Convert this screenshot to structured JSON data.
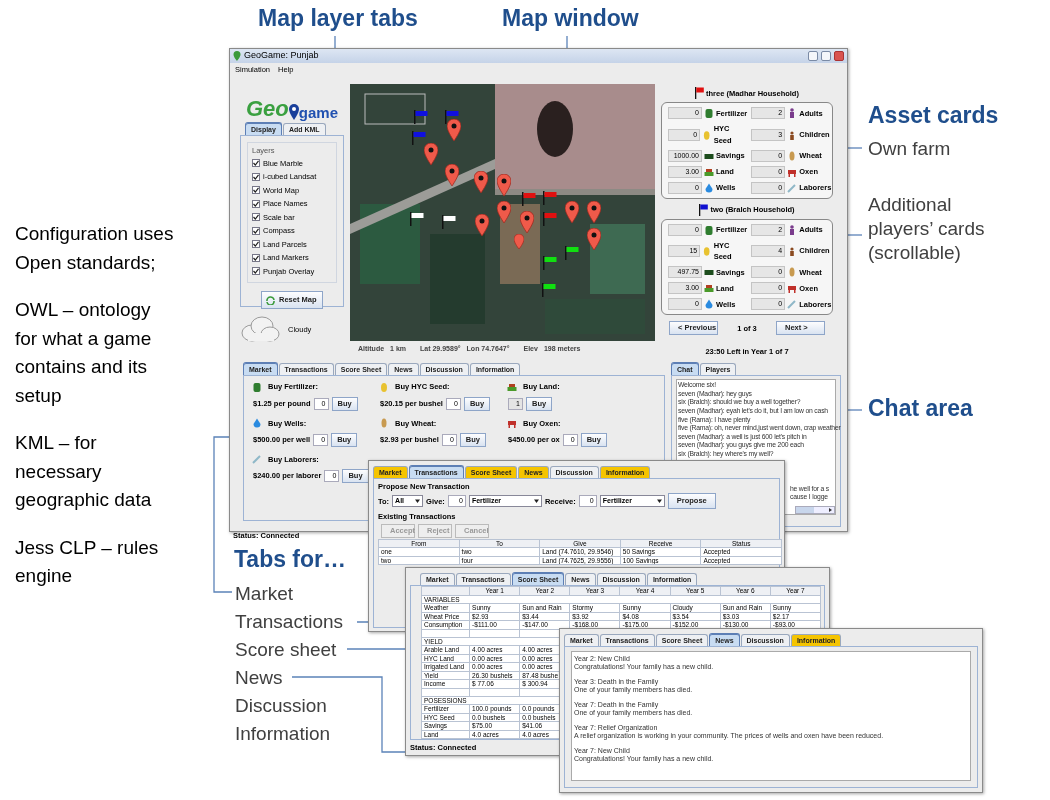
{
  "slide_notes": {
    "map_layer_tabs": "Map layer tabs",
    "map_window": "Map window",
    "asset_cards": "Asset cards",
    "own_farm": "Own farm",
    "additional": "Additional players’ cards (scrollable)",
    "chat_area": "Chat area",
    "tabs_for": "Tabs for…",
    "tab_list": [
      "Market",
      "Transactions",
      "Score sheet",
      "News",
      "Discussion",
      "Information"
    ],
    "left": [
      "Configuration uses Open standards;",
      "OWL – ontology for what a game contains and its setup",
      "KML – for necessary geographic data",
      "Jess CLP – rules engine"
    ]
  },
  "main_window": {
    "title": "GeoGame: Punjab",
    "menu": [
      "Simulation",
      "Help"
    ],
    "logo": {
      "left": "Geo",
      "right": "game"
    },
    "layer_tabs": [
      {
        "label": "Display",
        "selected": true
      },
      {
        "label": "Add KML",
        "selected": false
      }
    ],
    "layers": {
      "title": "Layers",
      "items": [
        {
          "label": "Blue Marble",
          "checked": true
        },
        {
          "label": "i-cubed Landsat",
          "checked": true
        },
        {
          "label": "World Map",
          "checked": true
        },
        {
          "label": "Place Names",
          "checked": true
        },
        {
          "label": "Scale bar",
          "checked": true
        },
        {
          "label": "Compass",
          "checked": true
        },
        {
          "label": "Land Parcels",
          "checked": true
        },
        {
          "label": "Land Markers",
          "checked": true
        },
        {
          "label": "Punjab Overlay",
          "checked": true
        }
      ]
    },
    "reset_button": "Reset Map",
    "weather": "Cloudy",
    "map": {
      "kind": "picture"
    },
    "map_readout": [
      "Altitude",
      "1 km",
      "Lat 29.9589°",
      "Lon 74.7647°",
      "Elev",
      "198 meters"
    ],
    "households": [
      {
        "title": "three (Madhar Household)",
        "color": "#e01010",
        "assets": [
          {
            "kind": "fertilizer",
            "label": "Fertilizer",
            "value": "0"
          },
          {
            "kind": "adults",
            "label": "Adults",
            "value": "2"
          },
          {
            "kind": "seed",
            "label": "HYC Seed",
            "value": "0"
          },
          {
            "kind": "children",
            "label": "Children",
            "value": "3"
          },
          {
            "kind": "savings",
            "label": "Savings",
            "value": "1000.00"
          },
          {
            "kind": "wheat",
            "label": "Wheat",
            "value": "0"
          },
          {
            "kind": "land",
            "label": "Land",
            "value": "3.00"
          },
          {
            "kind": "oxen",
            "label": "Oxen",
            "value": "0"
          },
          {
            "kind": "wells",
            "label": "Wells",
            "value": "0"
          },
          {
            "kind": "laborers",
            "label": "Laborers",
            "value": "0"
          }
        ]
      },
      {
        "title": "two (Bralch Household)",
        "color": "#1010d0",
        "assets": [
          {
            "kind": "fertilizer",
            "label": "Fertilizer",
            "value": "0"
          },
          {
            "kind": "adults",
            "label": "Adults",
            "value": "2"
          },
          {
            "kind": "seed",
            "label": "HYC Seed",
            "value": "15"
          },
          {
            "kind": "children",
            "label": "Children",
            "value": "4"
          },
          {
            "kind": "savings",
            "label": "Savings",
            "value": "497.75"
          },
          {
            "kind": "wheat",
            "label": "Wheat",
            "value": "0"
          },
          {
            "kind": "land",
            "label": "Land",
            "value": "3.00"
          },
          {
            "kind": "oxen",
            "label": "Oxen",
            "value": "0"
          },
          {
            "kind": "wells",
            "label": "Wells",
            "value": "0"
          },
          {
            "kind": "laborers",
            "label": "Laborers",
            "value": "0"
          }
        ]
      }
    ],
    "pager": {
      "previous": "< Previous",
      "page": "1 of 3",
      "next": "Next >"
    },
    "time_left": "23:50 Left in Year 1 of 7",
    "tabs": [
      {
        "label": "Market",
        "selected": true
      },
      {
        "label": "Transactions",
        "selected": false
      },
      {
        "label": "Score Sheet",
        "selected": false
      },
      {
        "label": "News",
        "selected": false
      },
      {
        "label": "Discussion",
        "selected": false
      },
      {
        "label": "Information",
        "selected": false
      }
    ],
    "market": [
      {
        "kind": "fertilizer",
        "label": "Buy Fertilizer:",
        "price": "$1.25 per pound",
        "quantity": "0",
        "button": "Buy",
        "disabled": false
      },
      {
        "kind": "seed",
        "label": "Buy HYC Seed:",
        "price": "$20.15 per bushel",
        "quantity": "0",
        "button": "Buy",
        "disabled": false
      },
      {
        "kind": "land",
        "label": "Buy Land:",
        "quantity": "1",
        "button": "Buy",
        "disabled": true
      },
      {
        "kind": "wells",
        "label": "Buy Wells:",
        "price": "$500.00 per well",
        "quantity": "0",
        "button": "Buy",
        "disabled": false
      },
      {
        "kind": "wheat",
        "label": "Buy Wheat:",
        "price": "$2.93 per bushel",
        "quantity": "0",
        "button": "Buy",
        "disabled": false
      },
      {
        "kind": "oxen",
        "label": "Buy Oxen:",
        "price": "$450.00 per ox",
        "quantity": "0",
        "button": "Buy",
        "disabled": false
      },
      {
        "kind": "laborers",
        "label": "Buy Laborers:",
        "price": "$240.00 per laborer",
        "quantity": "0",
        "button": "Buy",
        "disabled": false
      }
    ],
    "chat_tabs": [
      {
        "label": "Chat",
        "selected": true
      },
      {
        "label": "Players",
        "selected": false
      }
    ],
    "chat_lines": [
      {
        "kind": "line",
        "text": "Welcome six!"
      },
      {
        "kind": "line",
        "text": "seven (Madhar): hey guys"
      },
      {
        "kind": "line",
        "text": "six (Bralch): should we buy a well together?"
      },
      {
        "kind": "line",
        "text": "seven (Madhar): eyah let's do it, but I am low on cash"
      },
      {
        "kind": "line",
        "text": "five (Rama): I have plenty"
      },
      {
        "kind": "line",
        "text": "five (Rama): oh, never mind,just went down, crap weather"
      },
      {
        "kind": "line",
        "text": "seven (Madhar): a well is just 600 let's pitch in"
      },
      {
        "kind": "line",
        "text": "seven (Madhar): you guys give me 200 each"
      },
      {
        "kind": "line",
        "text": "six (Bralch): hey where's my well?"
      },
      {
        "kind": "tail",
        "text": "he well for a s"
      },
      {
        "kind": "tail",
        "text": "cause I logge"
      }
    ],
    "status": "Status: Connected"
  },
  "transactions_window": {
    "tabs": [
      {
        "label": "Market",
        "selected": false,
        "highlighted": true
      },
      {
        "label": "Transactions",
        "selected": true,
        "highlighted": false
      },
      {
        "label": "Score Sheet",
        "selected": false,
        "highlighted": true
      },
      {
        "label": "News",
        "selected": false,
        "highlighted": true
      },
      {
        "label": "Discussion",
        "selected": false,
        "highlighted": false
      },
      {
        "label": "Information",
        "selected": false,
        "highlighted": true
      }
    ],
    "propose_title": "Propose New Transaction",
    "to_label": "To:",
    "to_value": "All",
    "give_label": "Give:",
    "give_amount": "0",
    "give_item": "Fertilizer",
    "receive_label": "Receive:",
    "receive_amount": "0",
    "receive_item": "Fertilizer",
    "propose_button": "Propose",
    "existing_title": "Existing Transactions",
    "actions": [
      {
        "label": "Accept",
        "disabled": true
      },
      {
        "label": "Reject",
        "disabled": true
      },
      {
        "label": "Cancel",
        "disabled": true
      }
    ],
    "columns": [
      "From",
      "To",
      "Give",
      "Receive",
      "Status"
    ],
    "rows": [
      [
        "one",
        "two",
        "Land (74.7610, 29.9546)",
        "50 Savings",
        "Accepted"
      ],
      [
        "two",
        "four",
        "Land (74.7625, 29.9556)",
        "100 Savings",
        "Accepted"
      ]
    ]
  },
  "score_window": {
    "tabs": [
      {
        "label": "Market",
        "selected": false
      },
      {
        "label": "Transactions",
        "selected": false
      },
      {
        "label": "Score Sheet",
        "selected": true
      },
      {
        "label": "News",
        "selected": false
      },
      {
        "label": "Discussion",
        "selected": false
      },
      {
        "label": "Information",
        "selected": false
      }
    ],
    "columns": [
      "Year 1",
      "Year 2",
      "Year 3",
      "Year 4",
      "Year 5",
      "Year 6",
      "Year 7"
    ],
    "rows": [
      {
        "kind": "section",
        "cells": [
          "VARIABLES"
        ]
      },
      {
        "kind": "data",
        "cells": [
          "Weather",
          "Sunny",
          "Sun and Rain",
          "Stormy",
          "Sunny",
          "Cloudy",
          "Sun and Rain",
          "Sunny"
        ]
      },
      {
        "kind": "data",
        "cells": [
          "Wheat Price",
          "$2.93",
          "$3.44",
          "$3.92",
          "$4.08",
          "$3.54",
          "$3.03",
          "$2.17"
        ]
      },
      {
        "kind": "data",
        "cells": [
          "Consumption",
          "-$111.00",
          "-$147.00",
          "-$168.00",
          "-$175.00",
          "-$152.00",
          "-$130.00",
          "-$93.00"
        ]
      },
      {
        "kind": "blank"
      },
      {
        "kind": "section",
        "cells": [
          "YIELD"
        ]
      },
      {
        "kind": "data",
        "cells": [
          "Arable Land",
          "4.00 acres",
          "4.00 acres"
        ]
      },
      {
        "kind": "data",
        "cells": [
          "HYC Land",
          "0.00 acres",
          "0.00 acres"
        ]
      },
      {
        "kind": "data",
        "cells": [
          "Irrigated Land",
          "0.00 acres",
          "0.00 acres"
        ]
      },
      {
        "kind": "data",
        "cells": [
          "Yield",
          "26.30 bushels",
          "87.48 bushe"
        ]
      },
      {
        "kind": "data",
        "cells": [
          "Income",
          "$ 77.06",
          "$ 300.94"
        ]
      },
      {
        "kind": "blank"
      },
      {
        "kind": "section",
        "cells": [
          "POSESSIONS"
        ]
      },
      {
        "kind": "data",
        "cells": [
          "Fertilizer",
          "100.0 pounds",
          "0.0 pounds"
        ]
      },
      {
        "kind": "data",
        "cells": [
          "HYC Seed",
          "0.0 bushels",
          "0.0 bushels"
        ]
      },
      {
        "kind": "data",
        "cells": [
          "Savings",
          "$75.00",
          "$41.06"
        ]
      },
      {
        "kind": "data",
        "cells": [
          "Land",
          "4.0 acres",
          "4.0 acres"
        ]
      }
    ],
    "status": "Status: Connected"
  },
  "news_window": {
    "tabs": [
      {
        "label": "Market",
        "selected": false,
        "highlighted": false
      },
      {
        "label": "Transactions",
        "selected": false,
        "highlighted": false
      },
      {
        "label": "Score Sheet",
        "selected": false,
        "highlighted": false
      },
      {
        "label": "News",
        "selected": true,
        "highlighted": false
      },
      {
        "label": "Discussion",
        "selected": false,
        "highlighted": false
      },
      {
        "label": "Information",
        "selected": false,
        "highlighted": true
      }
    ],
    "items": [
      {
        "headline": "Year 2: New Child",
        "body": "Congratulations!  Your family has a new child."
      },
      {
        "headline": "Year 3: Death in the Family",
        "body": "One of your family members has died."
      },
      {
        "headline": "Year 7: Death in the Family",
        "body": "One of your family members has died."
      },
      {
        "headline": "Year 7: Relief Organization",
        "body": "A relief organization is working in your community.  The prices of wells and oxen have been reduced."
      },
      {
        "headline": "Year 7: New Child",
        "body": "Congratulations!  Your family has a new child."
      }
    ]
  }
}
